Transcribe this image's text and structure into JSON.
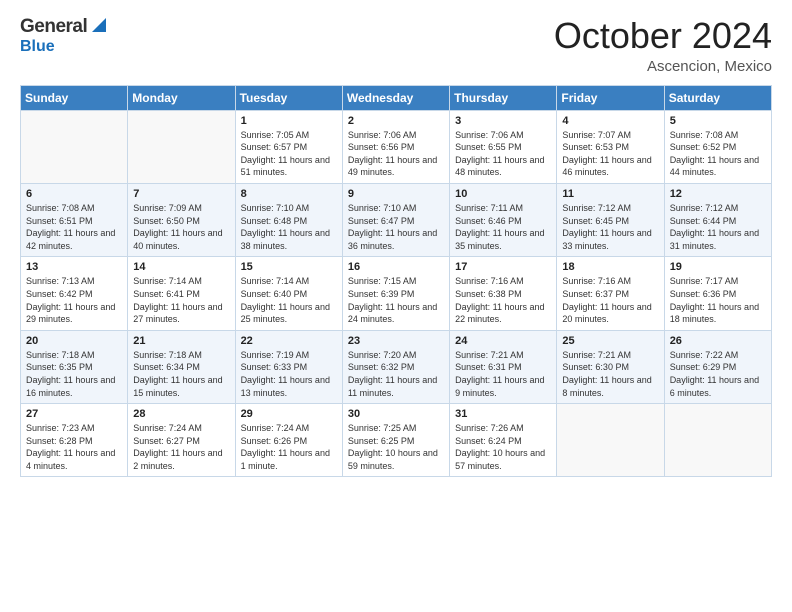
{
  "header": {
    "logo_general": "General",
    "logo_blue": "Blue",
    "month": "October 2024",
    "location": "Ascencion, Mexico"
  },
  "days_of_week": [
    "Sunday",
    "Monday",
    "Tuesday",
    "Wednesday",
    "Thursday",
    "Friday",
    "Saturday"
  ],
  "weeks": [
    [
      {
        "day": "",
        "sunrise": "",
        "sunset": "",
        "daylight": ""
      },
      {
        "day": "",
        "sunrise": "",
        "sunset": "",
        "daylight": ""
      },
      {
        "day": "1",
        "sunrise": "Sunrise: 7:05 AM",
        "sunset": "Sunset: 6:57 PM",
        "daylight": "Daylight: 11 hours and 51 minutes."
      },
      {
        "day": "2",
        "sunrise": "Sunrise: 7:06 AM",
        "sunset": "Sunset: 6:56 PM",
        "daylight": "Daylight: 11 hours and 49 minutes."
      },
      {
        "day": "3",
        "sunrise": "Sunrise: 7:06 AM",
        "sunset": "Sunset: 6:55 PM",
        "daylight": "Daylight: 11 hours and 48 minutes."
      },
      {
        "day": "4",
        "sunrise": "Sunrise: 7:07 AM",
        "sunset": "Sunset: 6:53 PM",
        "daylight": "Daylight: 11 hours and 46 minutes."
      },
      {
        "day": "5",
        "sunrise": "Sunrise: 7:08 AM",
        "sunset": "Sunset: 6:52 PM",
        "daylight": "Daylight: 11 hours and 44 minutes."
      }
    ],
    [
      {
        "day": "6",
        "sunrise": "Sunrise: 7:08 AM",
        "sunset": "Sunset: 6:51 PM",
        "daylight": "Daylight: 11 hours and 42 minutes."
      },
      {
        "day": "7",
        "sunrise": "Sunrise: 7:09 AM",
        "sunset": "Sunset: 6:50 PM",
        "daylight": "Daylight: 11 hours and 40 minutes."
      },
      {
        "day": "8",
        "sunrise": "Sunrise: 7:10 AM",
        "sunset": "Sunset: 6:48 PM",
        "daylight": "Daylight: 11 hours and 38 minutes."
      },
      {
        "day": "9",
        "sunrise": "Sunrise: 7:10 AM",
        "sunset": "Sunset: 6:47 PM",
        "daylight": "Daylight: 11 hours and 36 minutes."
      },
      {
        "day": "10",
        "sunrise": "Sunrise: 7:11 AM",
        "sunset": "Sunset: 6:46 PM",
        "daylight": "Daylight: 11 hours and 35 minutes."
      },
      {
        "day": "11",
        "sunrise": "Sunrise: 7:12 AM",
        "sunset": "Sunset: 6:45 PM",
        "daylight": "Daylight: 11 hours and 33 minutes."
      },
      {
        "day": "12",
        "sunrise": "Sunrise: 7:12 AM",
        "sunset": "Sunset: 6:44 PM",
        "daylight": "Daylight: 11 hours and 31 minutes."
      }
    ],
    [
      {
        "day": "13",
        "sunrise": "Sunrise: 7:13 AM",
        "sunset": "Sunset: 6:42 PM",
        "daylight": "Daylight: 11 hours and 29 minutes."
      },
      {
        "day": "14",
        "sunrise": "Sunrise: 7:14 AM",
        "sunset": "Sunset: 6:41 PM",
        "daylight": "Daylight: 11 hours and 27 minutes."
      },
      {
        "day": "15",
        "sunrise": "Sunrise: 7:14 AM",
        "sunset": "Sunset: 6:40 PM",
        "daylight": "Daylight: 11 hours and 25 minutes."
      },
      {
        "day": "16",
        "sunrise": "Sunrise: 7:15 AM",
        "sunset": "Sunset: 6:39 PM",
        "daylight": "Daylight: 11 hours and 24 minutes."
      },
      {
        "day": "17",
        "sunrise": "Sunrise: 7:16 AM",
        "sunset": "Sunset: 6:38 PM",
        "daylight": "Daylight: 11 hours and 22 minutes."
      },
      {
        "day": "18",
        "sunrise": "Sunrise: 7:16 AM",
        "sunset": "Sunset: 6:37 PM",
        "daylight": "Daylight: 11 hours and 20 minutes."
      },
      {
        "day": "19",
        "sunrise": "Sunrise: 7:17 AM",
        "sunset": "Sunset: 6:36 PM",
        "daylight": "Daylight: 11 hours and 18 minutes."
      }
    ],
    [
      {
        "day": "20",
        "sunrise": "Sunrise: 7:18 AM",
        "sunset": "Sunset: 6:35 PM",
        "daylight": "Daylight: 11 hours and 16 minutes."
      },
      {
        "day": "21",
        "sunrise": "Sunrise: 7:18 AM",
        "sunset": "Sunset: 6:34 PM",
        "daylight": "Daylight: 11 hours and 15 minutes."
      },
      {
        "day": "22",
        "sunrise": "Sunrise: 7:19 AM",
        "sunset": "Sunset: 6:33 PM",
        "daylight": "Daylight: 11 hours and 13 minutes."
      },
      {
        "day": "23",
        "sunrise": "Sunrise: 7:20 AM",
        "sunset": "Sunset: 6:32 PM",
        "daylight": "Daylight: 11 hours and 11 minutes."
      },
      {
        "day": "24",
        "sunrise": "Sunrise: 7:21 AM",
        "sunset": "Sunset: 6:31 PM",
        "daylight": "Daylight: 11 hours and 9 minutes."
      },
      {
        "day": "25",
        "sunrise": "Sunrise: 7:21 AM",
        "sunset": "Sunset: 6:30 PM",
        "daylight": "Daylight: 11 hours and 8 minutes."
      },
      {
        "day": "26",
        "sunrise": "Sunrise: 7:22 AM",
        "sunset": "Sunset: 6:29 PM",
        "daylight": "Daylight: 11 hours and 6 minutes."
      }
    ],
    [
      {
        "day": "27",
        "sunrise": "Sunrise: 7:23 AM",
        "sunset": "Sunset: 6:28 PM",
        "daylight": "Daylight: 11 hours and 4 minutes."
      },
      {
        "day": "28",
        "sunrise": "Sunrise: 7:24 AM",
        "sunset": "Sunset: 6:27 PM",
        "daylight": "Daylight: 11 hours and 2 minutes."
      },
      {
        "day": "29",
        "sunrise": "Sunrise: 7:24 AM",
        "sunset": "Sunset: 6:26 PM",
        "daylight": "Daylight: 11 hours and 1 minute."
      },
      {
        "day": "30",
        "sunrise": "Sunrise: 7:25 AM",
        "sunset": "Sunset: 6:25 PM",
        "daylight": "Daylight: 10 hours and 59 minutes."
      },
      {
        "day": "31",
        "sunrise": "Sunrise: 7:26 AM",
        "sunset": "Sunset: 6:24 PM",
        "daylight": "Daylight: 10 hours and 57 minutes."
      },
      {
        "day": "",
        "sunrise": "",
        "sunset": "",
        "daylight": ""
      },
      {
        "day": "",
        "sunrise": "",
        "sunset": "",
        "daylight": ""
      }
    ]
  ]
}
